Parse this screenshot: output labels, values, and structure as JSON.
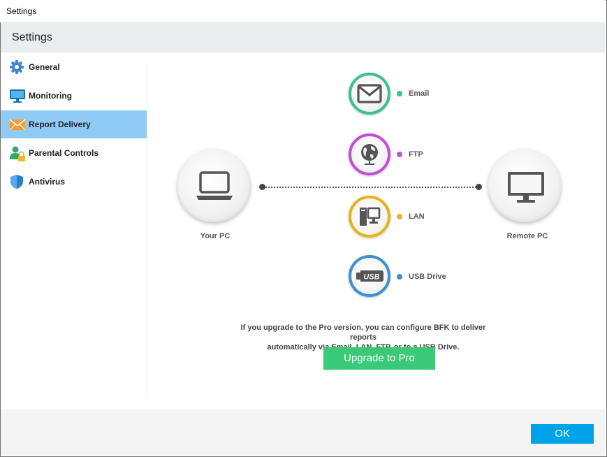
{
  "window": {
    "title": "Settings"
  },
  "header": {
    "title": "Settings"
  },
  "sidebar": {
    "items": [
      {
        "label": "General",
        "icon": "gear-icon",
        "active": false
      },
      {
        "label": "Monitoring",
        "icon": "monitor-icon",
        "active": false
      },
      {
        "label": "Report Delivery",
        "icon": "envelope-icon",
        "active": true
      },
      {
        "label": "Parental Controls",
        "icon": "parental-lock-icon",
        "active": false
      },
      {
        "label": "Antivirus",
        "icon": "shield-icon",
        "active": false
      }
    ]
  },
  "diagram": {
    "source_label": "Your PC",
    "target_label": "Remote PC",
    "methods": [
      {
        "label": "Email",
        "icon": "envelope-icon",
        "color": "#3dbf8f"
      },
      {
        "label": "FTP",
        "icon": "globe-icon",
        "color": "#c24fd6"
      },
      {
        "label": "LAN",
        "icon": "computer-tower-icon",
        "color": "#e2b51c"
      },
      {
        "label": "USB Drive",
        "icon": "usb-icon",
        "color": "#3d8fd1"
      }
    ]
  },
  "upgrade": {
    "message_line1": "If you upgrade to the Pro version, you can configure BFK to deliver reports",
    "message_line2": "automatically via Email, LAN, FTP, or to a USB Drive.",
    "button_label": "Upgrade to Pro"
  },
  "footer": {
    "ok_label": "OK"
  },
  "colors": {
    "active_sidebar": "#8fcbf5",
    "upgrade_button": "#3ac978",
    "ok_button": "#00a2e8"
  }
}
